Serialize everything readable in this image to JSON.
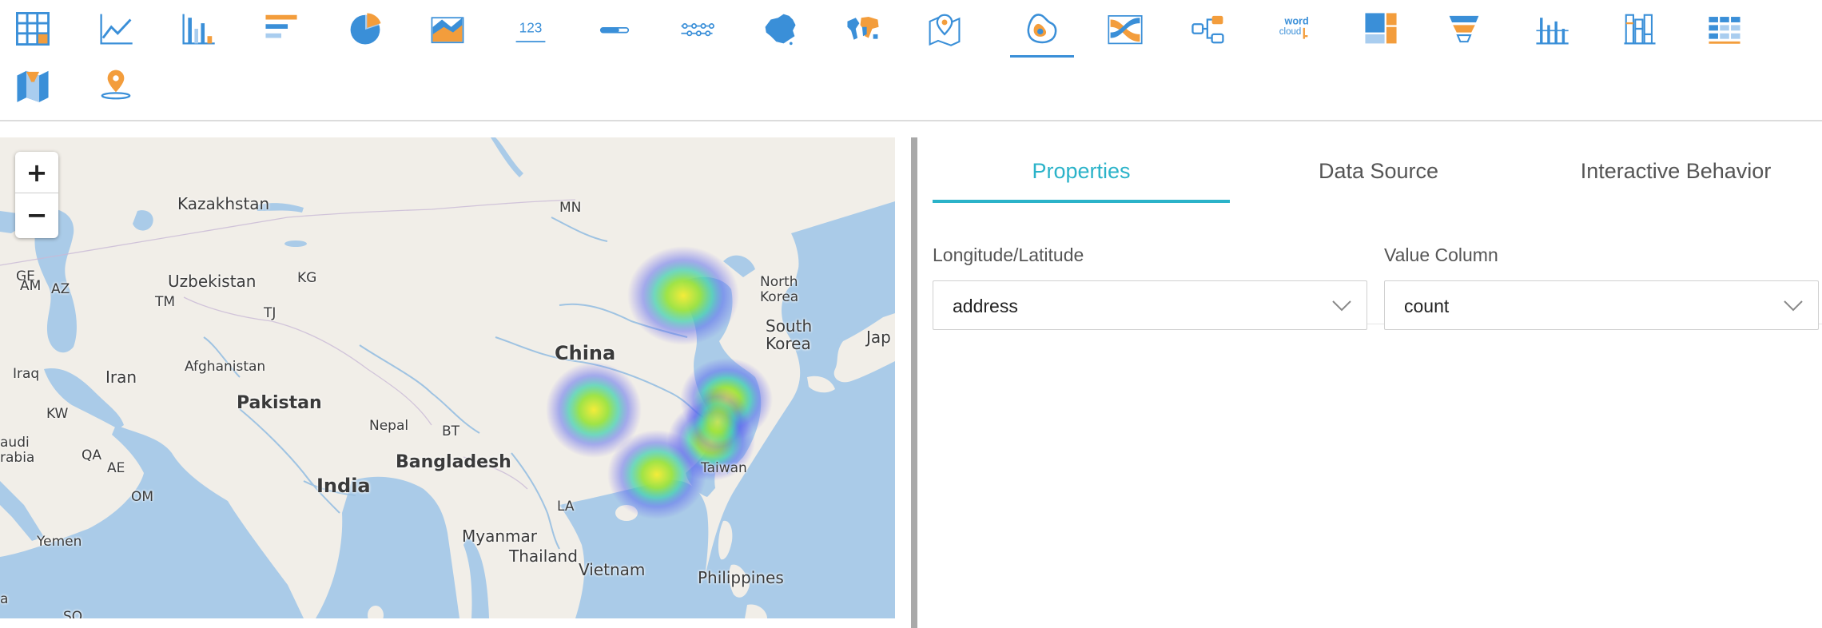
{
  "toolbar": {
    "icons": [
      "table-icon",
      "line-chart-icon",
      "column-chart-icon",
      "bar-chart-icon",
      "pie-chart-icon",
      "area-chart-icon",
      "kpi-number-icon",
      "progress-bar-icon",
      "timeline-icon",
      "china-map-icon",
      "world-map-icon",
      "pin-map-icon",
      "heatmap-icon",
      "sankey-icon",
      "tree-chart-icon",
      "word-cloud-icon",
      "treemap-icon",
      "funnel-icon",
      "bullet-chart-icon",
      "gauge-bar-icon",
      "pivot-table-icon",
      "area-map-icon",
      "location-map-icon"
    ],
    "selected_icon": "heatmap-icon",
    "word_cloud_text": {
      "line1": "word",
      "line2": "cloud"
    },
    "kpi_text": "123",
    "colors": {
      "blue": "#3a8fd8",
      "orange": "#f39d3c",
      "light_blue": "#a9cdef"
    }
  },
  "map": {
    "zoom_in_label": "+",
    "zoom_out_label": "−",
    "heat_points": [
      {
        "name": "Beijing area"
      },
      {
        "name": "Chengdu area"
      },
      {
        "name": "Shanghai area"
      },
      {
        "name": "Hangzhou area"
      },
      {
        "name": "Guangzhou area"
      }
    ],
    "labels": {
      "kazakhstan": "Kazakhstan",
      "mn": "MN",
      "uzbekistan": "Uzbekistan",
      "kg": "KG",
      "ge": "GE",
      "am": "AM",
      "az": "AZ",
      "tm": "TM",
      "tj": "TJ",
      "north_korea": "North\nKorea",
      "south_korea": "South\nKorea",
      "japan": "Jap",
      "china": "China",
      "iraq": "Iraq",
      "iran": "Iran",
      "afghanistan": "Afghanistan",
      "pakistan": "Pakistan",
      "kw": "KW",
      "nepal": "Nepal",
      "bt": "BT",
      "saudi": "audi\nrabia",
      "qa": "QA",
      "ae": "AE",
      "bangladesh": "Bangladesh",
      "taiwan": "Taiwan",
      "india": "India",
      "om": "OM",
      "la": "LA",
      "yemen": "Yemen",
      "myanmar": "Myanmar",
      "thailand": "Thailand",
      "vietnam": "Vietnam",
      "philippines": "Philippines",
      "so": "SO",
      "a": "a"
    },
    "colors": {
      "land": "#f1eee8",
      "water": "#aacbe8",
      "river": "#9fc3e2"
    }
  },
  "properties": {
    "tabs": [
      "Properties",
      "Data Source",
      "Interactive Behavior"
    ],
    "active_tab": "Properties",
    "longitude_label": "Longitude/Latitude",
    "longitude_value": "address",
    "value_label": "Value Column",
    "value_value": "count",
    "accent_color": "#2bb3c9"
  }
}
